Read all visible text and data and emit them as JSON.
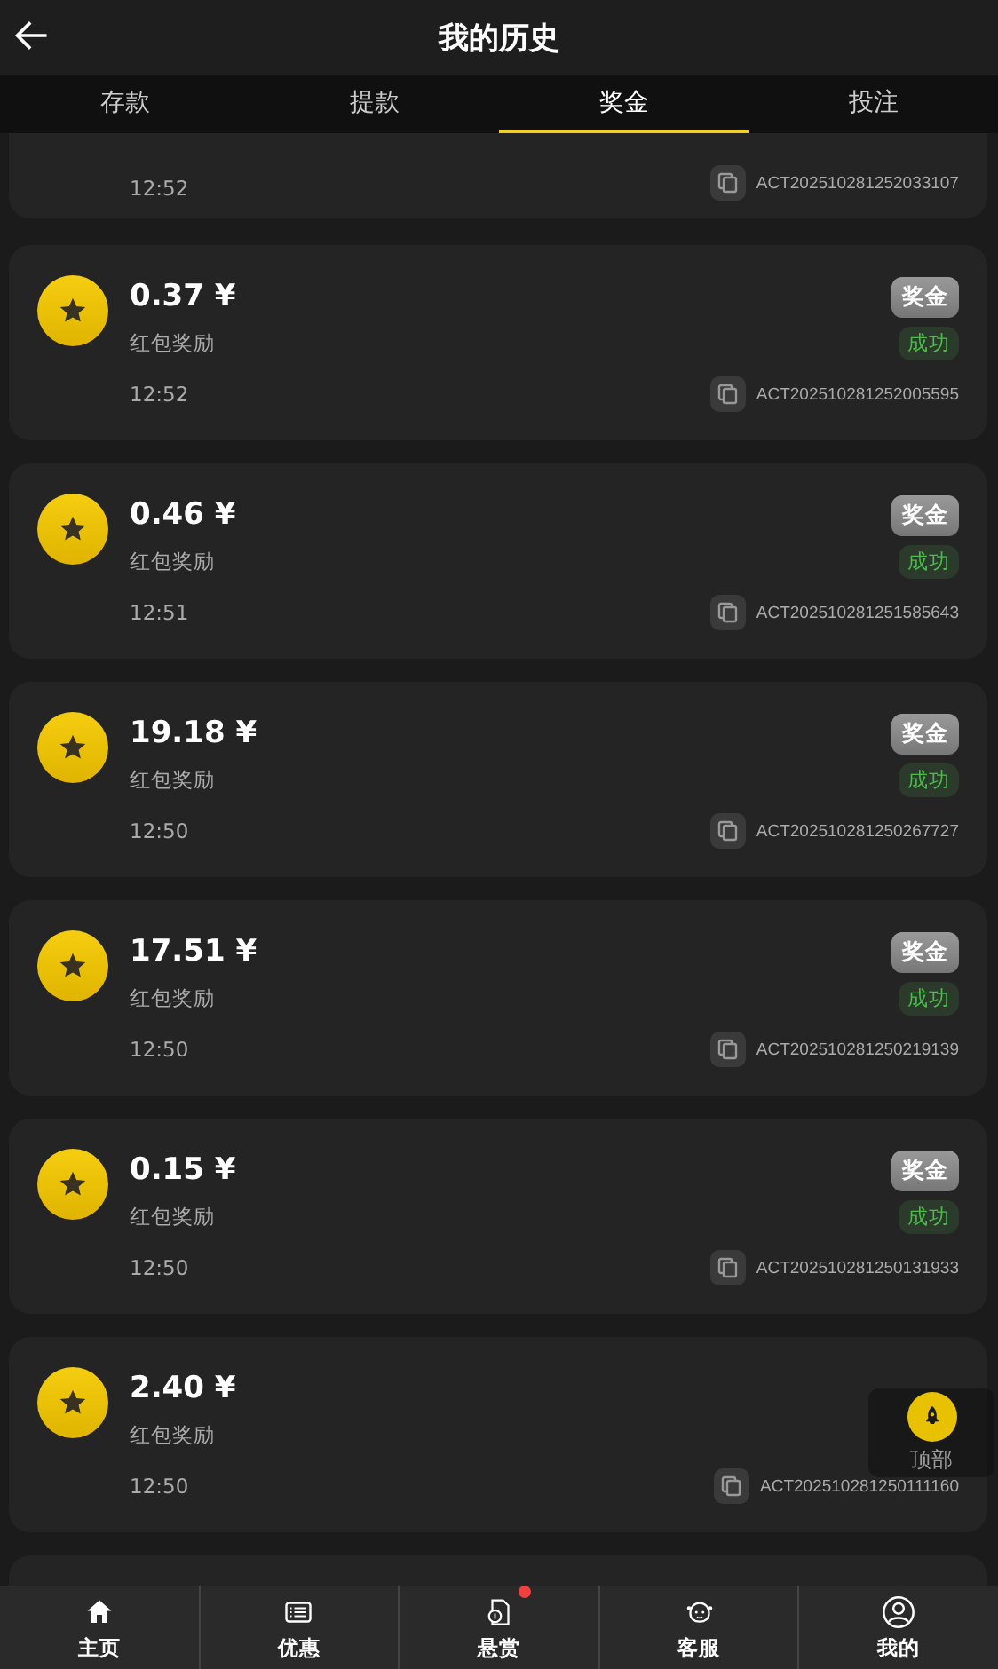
{
  "header": {
    "title": "我的历史"
  },
  "tabs": [
    {
      "label": "存款",
      "selected": false
    },
    {
      "label": "提款",
      "selected": false
    },
    {
      "label": "奖金",
      "selected": true
    },
    {
      "label": "投注",
      "selected": false
    }
  ],
  "records": [
    {
      "kind": "partial",
      "time": "12:52",
      "id": "ACT202510281252033107"
    },
    {
      "kind": "full",
      "amount": "0.37 ¥",
      "note": "红包奖励",
      "type": "奖金",
      "status": "成功",
      "time": "12:52",
      "id": "ACT202510281252005595"
    },
    {
      "kind": "full",
      "amount": "0.46 ¥",
      "note": "红包奖励",
      "type": "奖金",
      "status": "成功",
      "time": "12:51",
      "id": "ACT202510281251585643"
    },
    {
      "kind": "full",
      "amount": "19.18 ¥",
      "note": "红包奖励",
      "type": "奖金",
      "status": "成功",
      "time": "12:50",
      "id": "ACT202510281250267727"
    },
    {
      "kind": "full",
      "amount": "17.51 ¥",
      "note": "红包奖励",
      "type": "奖金",
      "status": "成功",
      "time": "12:50",
      "id": "ACT202510281250219139"
    },
    {
      "kind": "full",
      "amount": "0.15 ¥",
      "note": "红包奖励",
      "type": "奖金",
      "status": "成功",
      "time": "12:50",
      "id": "ACT202510281250131933"
    },
    {
      "kind": "full",
      "amount": "2.40 ¥",
      "note": "红包奖励",
      "time": "12:50",
      "id": "ACT202510281250111160"
    }
  ],
  "scroll_top": {
    "label": "顶部"
  },
  "nav": [
    {
      "kind": "home",
      "label": "主页",
      "dot": false
    },
    {
      "kind": "offers",
      "label": "优惠",
      "dot": false
    },
    {
      "kind": "bounty",
      "label": "悬赏",
      "dot": true
    },
    {
      "kind": "service",
      "label": "客服",
      "dot": false
    },
    {
      "kind": "profile",
      "label": "我的",
      "dot": false
    }
  ]
}
